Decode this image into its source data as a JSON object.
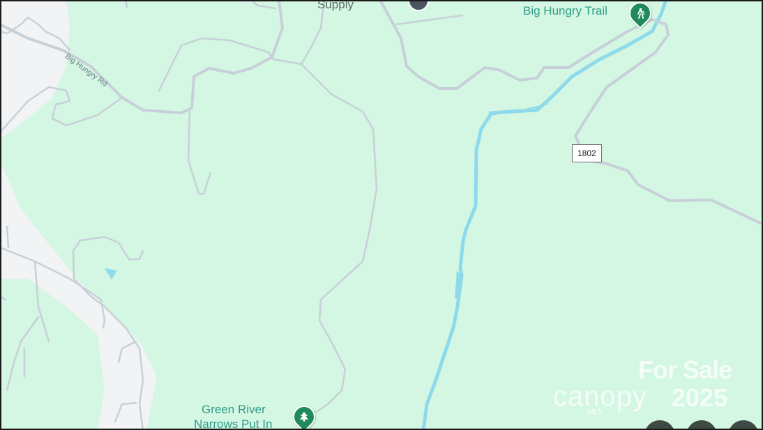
{
  "map": {
    "colors": {
      "land": "#d3f7e2",
      "urban": "#f2f3f4",
      "road": "#c7d0d8",
      "water": "#8ed9ea",
      "poi_park": "#1f8a5b"
    },
    "labels": {
      "top_supply": "Supply",
      "big_hungry_trail": "Big Hungry Trail",
      "big_hungry_rd": "Big Hungry Rd",
      "green_river_line1": "Green River",
      "green_river_line2": "Narrows Put In",
      "route_shield": "1802"
    },
    "icons": {
      "trail": "hiker-icon",
      "park": "tree-icon"
    },
    "watermark": {
      "line1": "For Sale",
      "brand": "canopy",
      "brand_sub": "MLS",
      "year": "2025"
    }
  }
}
